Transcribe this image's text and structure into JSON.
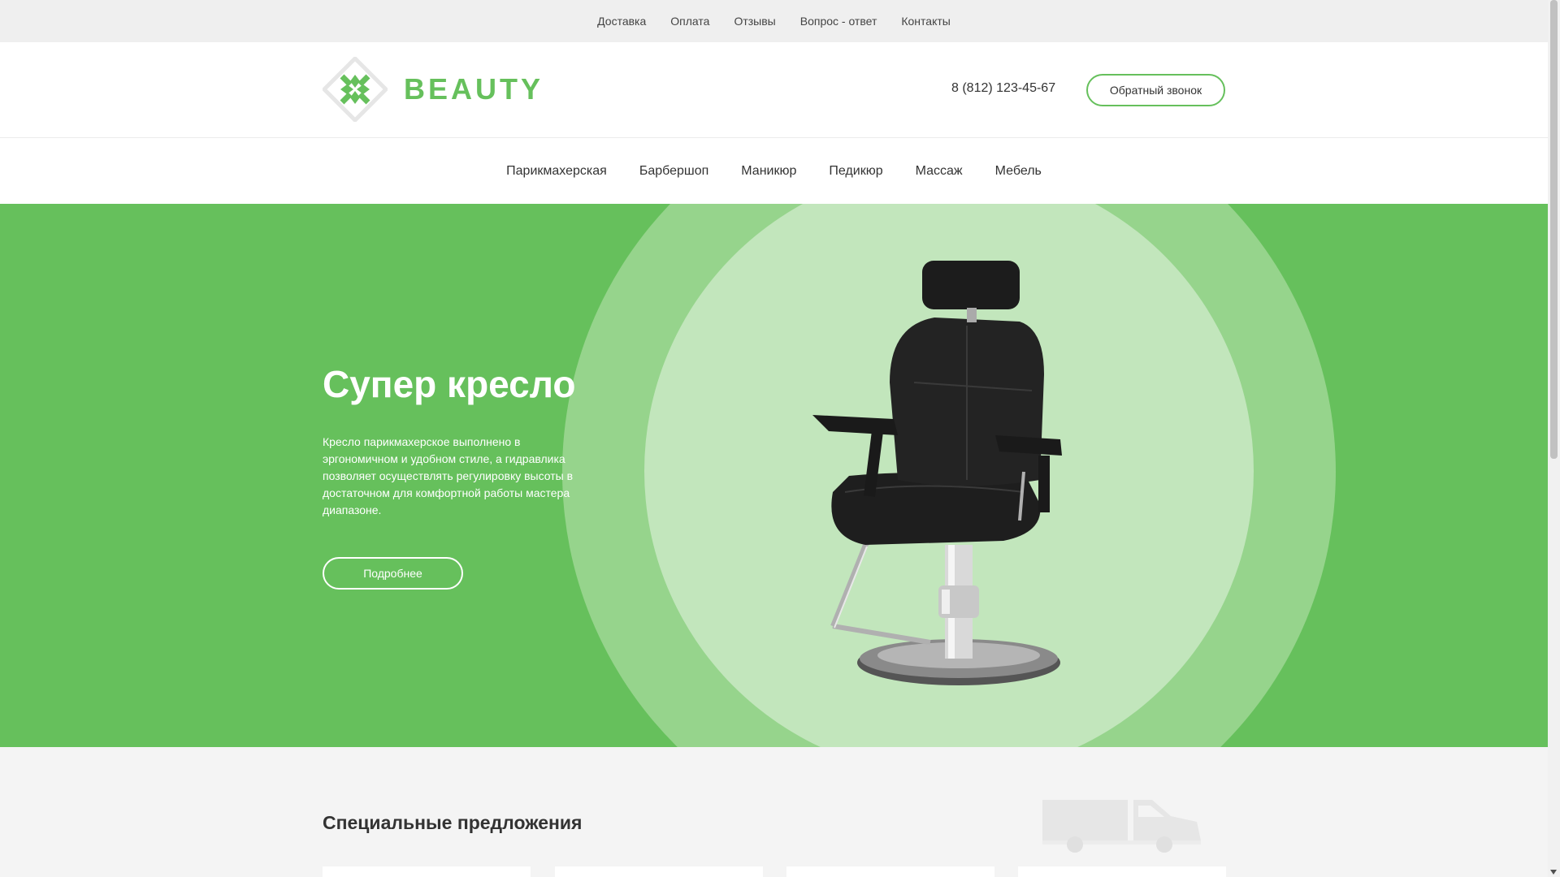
{
  "topbar": {
    "links": [
      "Доставка",
      "Оплата",
      "Отзывы",
      "Вопрос - ответ",
      "Контакты"
    ]
  },
  "header": {
    "logo_text": "BEAUTY",
    "phone": "8 (812) 123-45-67",
    "callback_label": "Обратный звонок"
  },
  "main_nav": {
    "items": [
      "Парикмахерская",
      "Барбершоп",
      "Маникюр",
      "Педикюр",
      "Массаж",
      "Мебель"
    ]
  },
  "hero": {
    "title": "Супер кресло",
    "description": "Кресло парикмахерское выполнено в эргономичном и удобном стиле, а гидравлика позволяет осуществлять регулировку высоты в достаточном для комфортной работы мастера диапазоне.",
    "button_label": "Подробнее",
    "image": "barber-chair-image"
  },
  "offers": {
    "title": "Специальные предложения",
    "decor_icon": "truck-icon",
    "cards": 4
  },
  "colors": {
    "accent": "#66c05c",
    "hero_bg": "#66c05c",
    "circle_outer": "#96d48c",
    "circle_inner": "#c2e6bc",
    "topbar_bg": "#efefef"
  }
}
